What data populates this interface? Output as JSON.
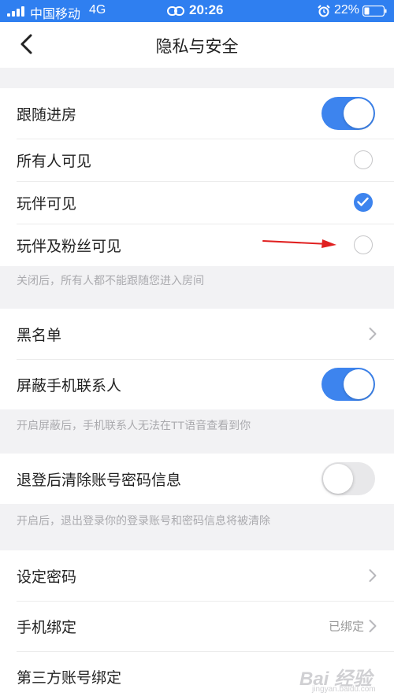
{
  "status_bar": {
    "carrier": "中国移动",
    "network": "4G",
    "time": "20:26",
    "battery": "22%",
    "icons": [
      "signal-icon",
      "link-icon",
      "alarm-icon",
      "battery-icon"
    ]
  },
  "header": {
    "title": "隐私与安全",
    "back_icon": "chevron-left-icon"
  },
  "follow_section": {
    "label": "跟随进房",
    "enabled": true,
    "options": [
      {
        "label": "所有人可见",
        "checked": false
      },
      {
        "label": "玩伴可见",
        "checked": true
      },
      {
        "label": "玩伴及粉丝可见",
        "checked": false
      }
    ],
    "hint": "关闭后，所有人都不能跟随您进入房间"
  },
  "blacklist_section": {
    "blacklist_label": "黑名单",
    "block_contacts_label": "屏蔽手机联系人",
    "block_contacts_enabled": true,
    "hint": "开启屏蔽后，手机联系人无法在TT语音查看到你"
  },
  "logout_section": {
    "label": "退登后清除账号密码信息",
    "enabled": false,
    "hint": "开启后，退出登录你的登录账号和密码信息将被清除"
  },
  "account_section": {
    "set_password_label": "设定密码",
    "phone_binding_label": "手机绑定",
    "phone_binding_status": "已绑定",
    "third_party_label": "第三方账号绑定"
  },
  "watermark": {
    "text": "Bai 经验",
    "sub": "jingyan.baidu.com"
  },
  "colors": {
    "accent": "#3d84ee",
    "status_bar": "#2f7ff0",
    "annotation_arrow": "#e02020"
  }
}
